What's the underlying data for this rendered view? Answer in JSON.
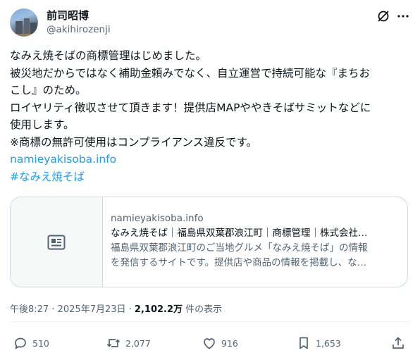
{
  "author": {
    "name": "前司昭博",
    "handle": "@akihirozenji"
  },
  "header_icons": [
    "grok-icon",
    "more-icon"
  ],
  "tweet": {
    "lines": [
      "なみえ焼そばの商標管理はじめました。",
      "被災地だからではなく補助金頼みでなく、自立運営で持続可能な『まちお",
      "こし』のため。",
      "ロイヤリティ徴収させて頂きます！提供店MAPややきそばサミットなどに",
      "使用します。",
      "※商標の無許可使用はコンプライアンス違反です。"
    ],
    "link": "namieyakisoba.info",
    "hashtag": "#なみえ焼そば"
  },
  "card": {
    "domain": "namieyakisoba.info",
    "title": "なみえ焼そば｜福島県双葉郡浪江町｜商標管理｜株式会社…",
    "desc_line1": "福島県双葉郡浪江町のご当地グルメ「なみえ焼そば」の情報",
    "desc_line2": "を発信するサイトです。提供店や商品の情報を掲載し、な…"
  },
  "meta": {
    "time": "午後8:27",
    "sep": " · ",
    "date": "2025年7月23日",
    "dot": " · ",
    "views": "2,102.2万",
    "views_label": " 件の表示"
  },
  "actions": {
    "replies": "510",
    "reposts": "2,077",
    "likes": "916",
    "bookmarks": "1,653"
  },
  "colors": {
    "link": "#1d9bf0",
    "secondary_text": "#536471",
    "border": "#cfd9de"
  }
}
